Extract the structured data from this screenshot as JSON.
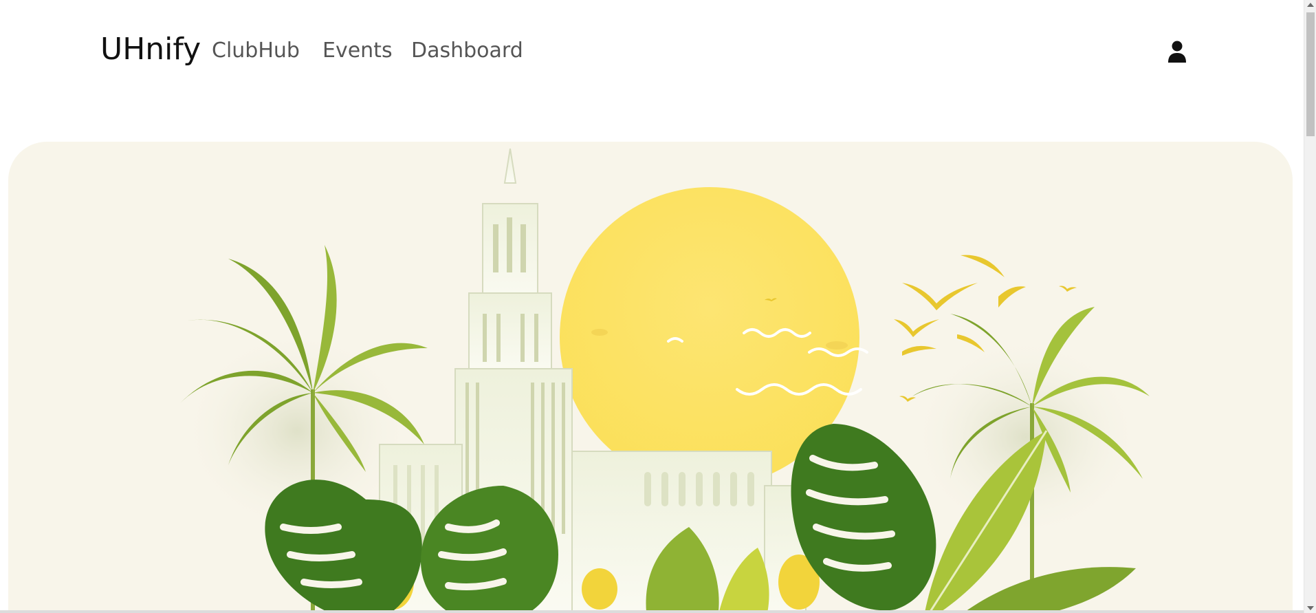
{
  "navbar": {
    "brand": "UHnify",
    "links": [
      {
        "label": "ClubHub"
      },
      {
        "label": "Events"
      },
      {
        "label": "Dashboard"
      }
    ],
    "user_icon": "user-icon"
  },
  "hero": {
    "image": "campus-illustration",
    "colors": {
      "background": "#f8f5ea",
      "sun": "#fde266",
      "leaf_dark": "#3f7a1f",
      "leaf_light": "#a9c43a",
      "building": "#f1f3e3"
    }
  },
  "scrollbar": {
    "thumb_color": "#c1c1c1"
  }
}
